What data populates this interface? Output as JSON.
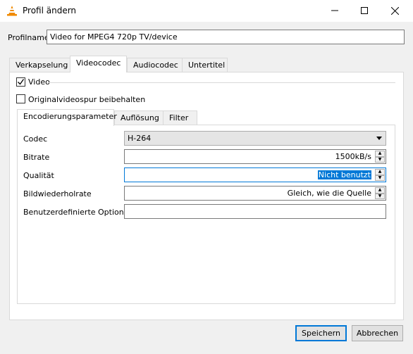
{
  "window": {
    "title": "Profil ändern"
  },
  "profile": {
    "label": "Profilname",
    "value": "Video for MPEG4 720p TV/device"
  },
  "main_tabs": [
    {
      "label": "Verkapselung"
    },
    {
      "label": "Videocodec"
    },
    {
      "label": "Audiocodec"
    },
    {
      "label": "Untertitel"
    }
  ],
  "video": {
    "enable_label": "Video",
    "keep_original_label": "Originalvideospur beibehalten"
  },
  "sub_tabs": [
    {
      "label": "Encodierungsparameter"
    },
    {
      "label": "Auflösung"
    },
    {
      "label": "Filter"
    }
  ],
  "params": {
    "codec_label": "Codec",
    "codec_value": "H-264",
    "bitrate_label": "Bitrate",
    "bitrate_value": "1500kB/s",
    "quality_label": "Qualität",
    "quality_value": "Nicht benutzt",
    "framerate_label": "Bildwiederholrate",
    "framerate_value": "Gleich, wie die Quelle",
    "custom_label": "Benutzerdefinierte Optionen",
    "custom_value": ""
  },
  "buttons": {
    "save": "Speichern",
    "cancel": "Abbrechen"
  }
}
